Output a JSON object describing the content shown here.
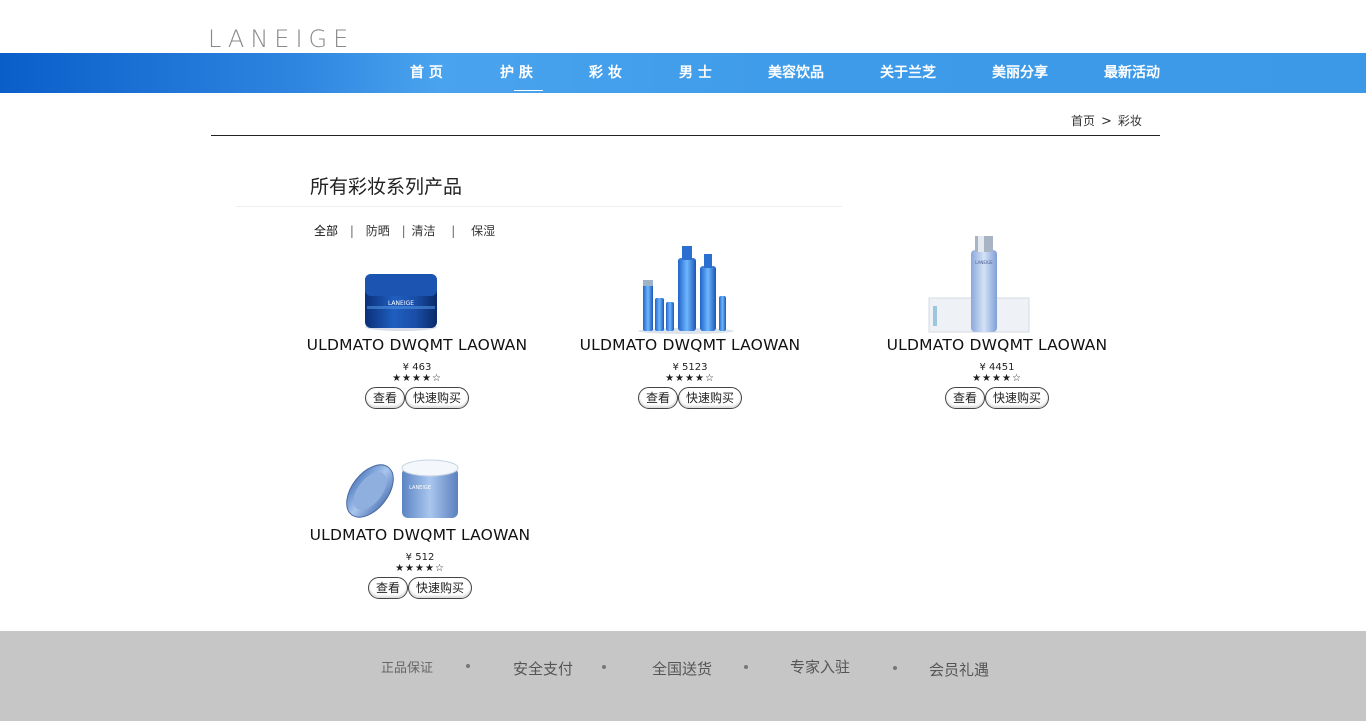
{
  "brand": {
    "logo_text": "LANEIGE"
  },
  "nav": {
    "items": [
      {
        "label": "首 页"
      },
      {
        "label": "护 肤"
      },
      {
        "label": "彩 妆"
      },
      {
        "label": "男 士"
      },
      {
        "label": "美容饮品"
      },
      {
        "label": "关于兰芝"
      },
      {
        "label": "美丽分享"
      },
      {
        "label": "最新活动"
      }
    ],
    "active": "护 肤"
  },
  "breadcrumb": {
    "home": "首页",
    "separator": ">",
    "current": "彩妆"
  },
  "section": {
    "title": "所有彩妆系列产品"
  },
  "filters": {
    "items": [
      {
        "label": "全部"
      },
      {
        "label": "防晒"
      },
      {
        "label": "清洁"
      },
      {
        "label": "保湿"
      }
    ],
    "separator": "|",
    "active": "全部"
  },
  "products": [
    {
      "name": "ULDMATO DWQMT LAOWAN",
      "price": "¥ 463",
      "rating": 4,
      "rating_max": 5,
      "image": "blue-cream-jar",
      "view_label": "查看",
      "buy_label": "快速购买"
    },
    {
      "name": "ULDMATO DWQMT LAOWAN",
      "price": "¥ 5123",
      "rating": 4,
      "rating_max": 5,
      "image": "blue-skincare-set",
      "view_label": "查看",
      "buy_label": "快速购买"
    },
    {
      "name": "ULDMATO DWQMT LAOWAN",
      "price": "¥ 4451",
      "rating": 4,
      "rating_max": 5,
      "image": "toner-bottle-with-box",
      "view_label": "查看",
      "buy_label": "快速购买"
    },
    {
      "name": "ULDMATO DWQMT LAOWAN",
      "price": "¥ 512",
      "rating": 4,
      "rating_max": 5,
      "image": "open-cream-jar",
      "view_label": "查看",
      "buy_label": "快速购买"
    }
  ],
  "footer": {
    "items": [
      {
        "label": "正品保证"
      },
      {
        "label": "安全支付"
      },
      {
        "label": "全国送货"
      },
      {
        "label": "专家入驻"
      },
      {
        "label": "会员礼遇"
      }
    ]
  },
  "colors": {
    "nav_blue": "#3b99e8",
    "nav_dark_blue": "#0a5ec9",
    "footer_gray": "#c6c6c6"
  }
}
